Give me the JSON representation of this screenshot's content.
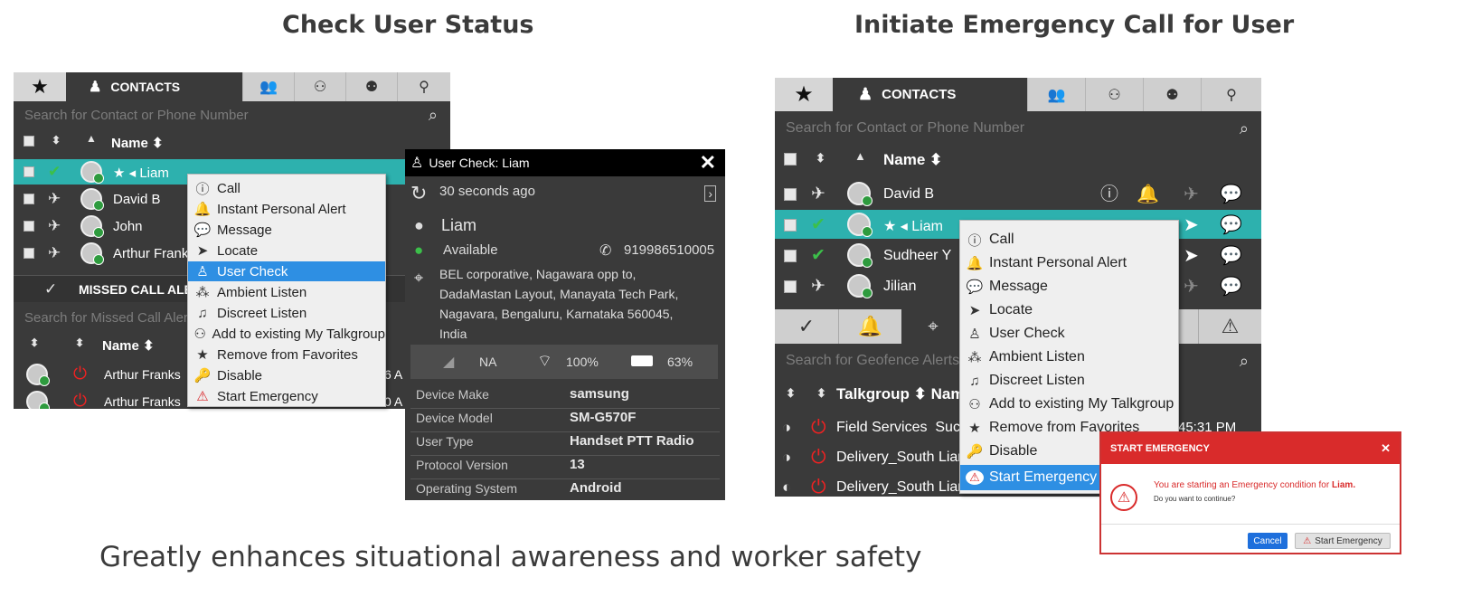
{
  "headings": {
    "left": "Check User Status",
    "right": "Initiate Emergency Call for User"
  },
  "caption": "Greatly enhances situational awareness and worker safety",
  "left_panel": {
    "contacts_tab": "CONTACTS",
    "search_placeholder": "Search for Contact or Phone Number",
    "name_header": "Name",
    "contacts": [
      "Liam",
      "David B",
      "John",
      "Arthur Franks"
    ],
    "missed_call_tab": "MISSED CALL ALERTS",
    "missed_search": "Search for Missed Call Alerts",
    "missed_header": "Name",
    "missed_rows": [
      "Arthur Franks",
      "Arthur Franks"
    ],
    "missed_tail": [
      "6 A",
      "0 A"
    ]
  },
  "menu_items": [
    "Call",
    "Instant Personal Alert",
    "Message",
    "Locate",
    "User Check",
    "Ambient Listen",
    "Discreet Listen",
    "Add to existing My Talkgroup",
    "Remove from Favorites",
    "Disable",
    "Start Emergency"
  ],
  "user_check": {
    "title": "User Check: Liam",
    "ago": "30 seconds ago",
    "name": "Liam",
    "status": "Available",
    "phone": "919986510005",
    "address": [
      "BEL corporative, Nagawara opp to,",
      "DadaMastan Layout, Manayata Tech Park,",
      "Nagavara, Bengaluru, Karnataka 560045,",
      "India"
    ],
    "signal": "NA",
    "wifi": "100%",
    "battery": "63%",
    "details": [
      {
        "key": "Device Make",
        "value": "samsung"
      },
      {
        "key": "Device Model",
        "value": "SM-G570F"
      },
      {
        "key": "User Type",
        "value": "Handset PTT Radio"
      },
      {
        "key": "Protocol Version",
        "value": "13"
      },
      {
        "key": "Operating System",
        "value": "Android"
      }
    ]
  },
  "right_panel": {
    "contacts_tab": "CONTACTS",
    "search_placeholder": "Search for Contact or Phone Number",
    "name_header": "Name",
    "contacts": [
      "David B",
      "Liam",
      "Sudheer Y",
      "Jilian"
    ],
    "geofence_search": "Search for Geofence Alerts",
    "talkgroup_header": "Talkgroup",
    "name_header_2": "Nam",
    "alerts": [
      "Field Services",
      "Delivery_South",
      "Delivery_South"
    ],
    "alert_tails": [
      "Suc",
      "Liar",
      "Liar"
    ],
    "time": "45:31 PM"
  },
  "dialog": {
    "title": "START EMERGENCY",
    "message_prefix": "You are starting an Emergency condition for",
    "user": "Liam.",
    "question": "Do you want to continue?",
    "cancel": "Cancel",
    "confirm": "Start Emergency"
  },
  "colors": {
    "teal_selection": "#2db1ae",
    "menu_highlight": "#2e8fe3",
    "emergency_red": "#d92b2b"
  }
}
